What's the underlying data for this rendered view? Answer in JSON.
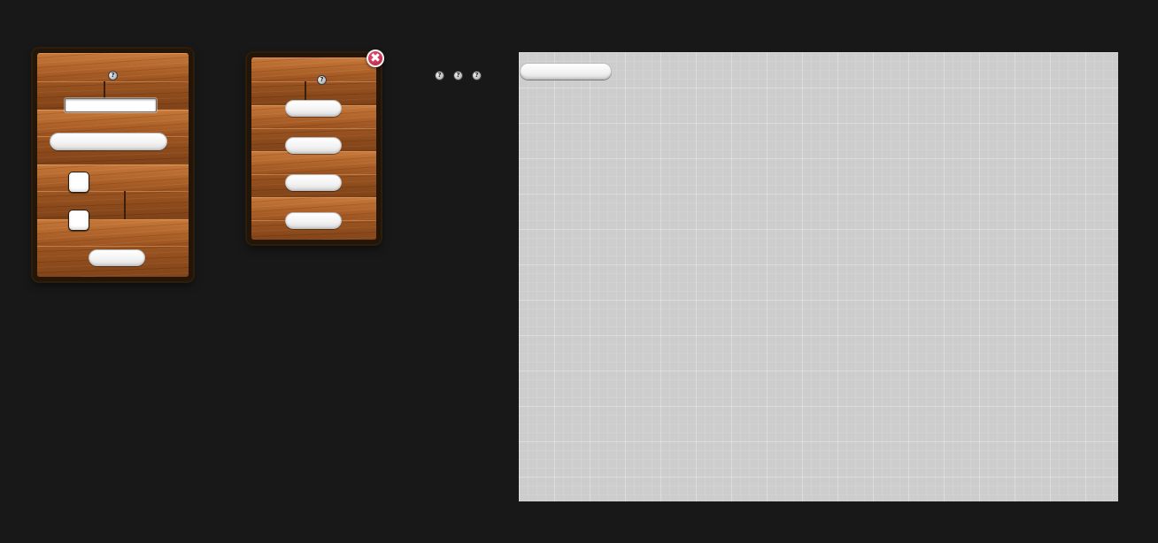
{
  "icons": {
    "help_glyph": "?",
    "close_glyph": "✖"
  },
  "settings_panel": {
    "help_icon": "help-icon",
    "name_input": {
      "value": "",
      "placeholder": ""
    },
    "wide_field": "",
    "checkboxes": [
      {
        "checked": false
      },
      {
        "checked": false
      }
    ],
    "confirm_field": ""
  },
  "menu_panel": {
    "help_icon": "help-icon",
    "close_icon": "close-icon",
    "items": [
      "",
      "",
      "",
      ""
    ]
  },
  "toolbar": {
    "help_icons": [
      "help-icon",
      "help-icon",
      "help-icon"
    ]
  },
  "canvas": {
    "title_field": ""
  },
  "colors": {
    "background": "#181818",
    "wood": "#b66a2f",
    "wood_frame": "#231507",
    "canvas": "#cdcdcd",
    "close_button": "#c8325a"
  }
}
